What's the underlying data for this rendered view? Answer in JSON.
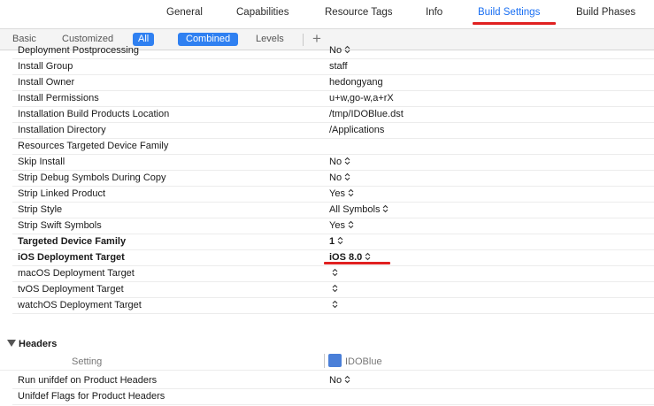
{
  "tabs": [
    {
      "label": "General",
      "active": false
    },
    {
      "label": "Capabilities",
      "active": false
    },
    {
      "label": "Resource Tags",
      "active": false
    },
    {
      "label": "Info",
      "active": false
    },
    {
      "label": "Build Settings",
      "active": true
    },
    {
      "label": "Build Phases",
      "active": false
    }
  ],
  "filters": {
    "basic": "Basic",
    "customized": "Customized",
    "all": "All",
    "combined": "Combined",
    "levels": "Levels",
    "add": "+"
  },
  "rows": [
    {
      "label": "Deployment Postprocessing",
      "value": "No",
      "popup": true,
      "bold": false
    },
    {
      "label": "Install Group",
      "value": "staff",
      "popup": false,
      "bold": false
    },
    {
      "label": "Install Owner",
      "value": "hedongyang",
      "popup": false,
      "bold": false
    },
    {
      "label": "Install Permissions",
      "value": "u+w,go-w,a+rX",
      "popup": false,
      "bold": false
    },
    {
      "label": "Installation Build Products Location",
      "value": "/tmp/IDOBlue.dst",
      "popup": false,
      "bold": false
    },
    {
      "label": "Installation Directory",
      "value": "/Applications",
      "popup": false,
      "bold": false
    },
    {
      "label": "Resources Targeted Device Family",
      "value": "",
      "popup": false,
      "bold": false
    },
    {
      "label": "Skip Install",
      "value": "No",
      "popup": true,
      "bold": false
    },
    {
      "label": "Strip Debug Symbols During Copy",
      "value": "No",
      "popup": true,
      "bold": false
    },
    {
      "label": "Strip Linked Product",
      "value": "Yes",
      "popup": true,
      "bold": false
    },
    {
      "label": "Strip Style",
      "value": "All Symbols",
      "popup": true,
      "bold": false
    },
    {
      "label": "Strip Swift Symbols",
      "value": "Yes",
      "popup": true,
      "bold": false
    },
    {
      "label": "Targeted Device Family",
      "value": "1",
      "popup": true,
      "bold": true
    },
    {
      "label": "iOS Deployment Target",
      "value": "iOS 8.0",
      "popup": true,
      "bold": true
    },
    {
      "label": "macOS Deployment Target",
      "value": "",
      "popup": true,
      "bold": false
    },
    {
      "label": "tvOS Deployment Target",
      "value": "",
      "popup": true,
      "bold": false
    },
    {
      "label": "watchOS Deployment Target",
      "value": "",
      "popup": true,
      "bold": false
    }
  ],
  "headers_section": {
    "title": "Headers",
    "setting_col": "Setting",
    "target_col": "IDOBlue"
  },
  "header_rows": [
    {
      "label": "Run unifdef on Product Headers",
      "value": "No",
      "popup": true
    },
    {
      "label": "Unifdef Flags for Product Headers",
      "value": "",
      "popup": false
    }
  ],
  "colors": {
    "accent": "#2f80f1",
    "annotation": "#e02020"
  }
}
